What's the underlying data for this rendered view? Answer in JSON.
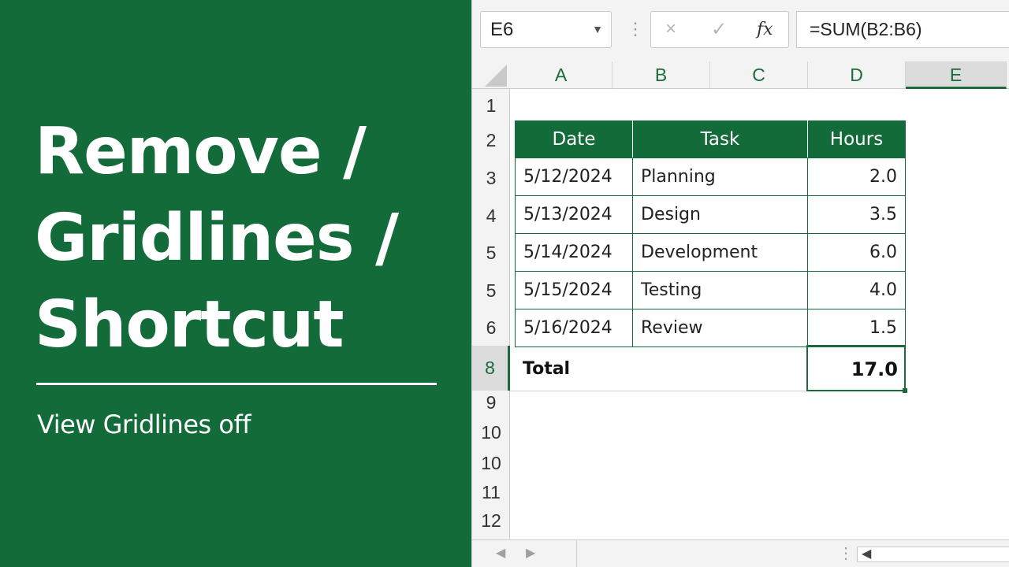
{
  "title_lines": [
    "Remove /",
    "Gridlines /",
    "Shortcut"
  ],
  "subtitle": "View Gridlines off",
  "formula_bar": {
    "name_box": "E6",
    "cancel_icon": "×",
    "enter_icon": "✓",
    "fx_label": "fx",
    "formula": "=SUM(B2:B6)"
  },
  "columns": [
    "A",
    "B",
    "C",
    "D",
    "E"
  ],
  "selected_column": "E",
  "rows": [
    "1",
    "2",
    "3",
    "4",
    "5",
    "5",
    "6",
    "8",
    "9",
    "10",
    "10",
    "11",
    "12"
  ],
  "selected_row": "8",
  "table": {
    "headers": [
      "Date",
      "Task",
      "Hours"
    ],
    "rows": [
      [
        "5/12/2024",
        "Planning",
        "2.0"
      ],
      [
        "5/13/2024",
        "Design",
        "3.5"
      ],
      [
        "5/14/2024",
        "Development",
        "6.0"
      ],
      [
        "5/15/2024",
        "Testing",
        "4.0"
      ],
      [
        "5/16/2024",
        "Review",
        "1.5"
      ]
    ],
    "total_label": "Total",
    "total_value": "17.0"
  },
  "colors": {
    "brand_green": "#136b3a",
    "accent_green": "#1c6b3b"
  }
}
